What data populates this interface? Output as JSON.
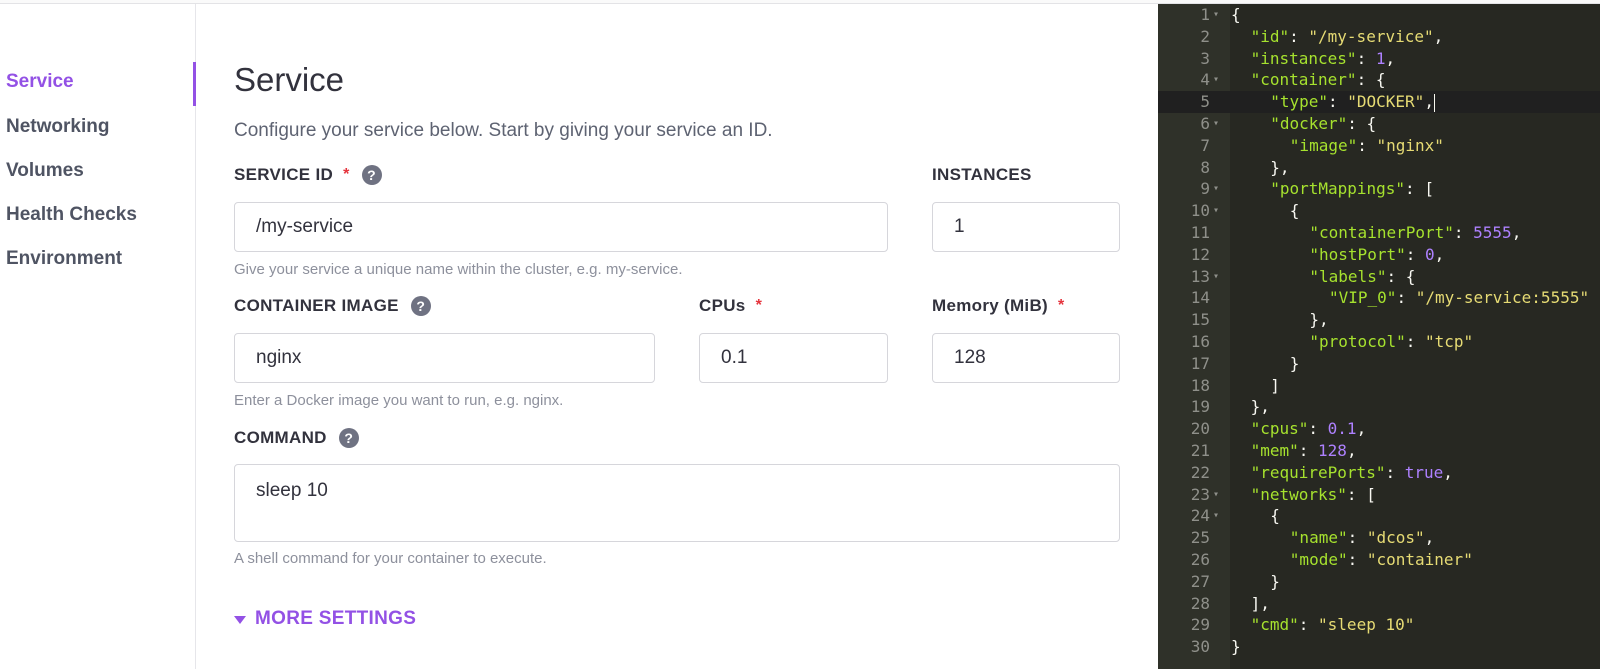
{
  "sidebar": {
    "items": [
      {
        "label": "Service",
        "active": true
      },
      {
        "label": "Networking",
        "active": false
      },
      {
        "label": "Volumes",
        "active": false
      },
      {
        "label": "Health Checks",
        "active": false
      },
      {
        "label": "Environment",
        "active": false
      }
    ]
  },
  "main": {
    "title": "Service",
    "description": "Configure your service below. Start by giving your service an ID.",
    "help_icon": "?",
    "required_mark": "*",
    "service_id": {
      "label": "SERVICE ID",
      "value": "/my-service",
      "hint": "Give your service a unique name within the cluster, e.g. my-service."
    },
    "instances": {
      "label": "INSTANCES",
      "value": "1"
    },
    "container_image": {
      "label": "CONTAINER IMAGE",
      "value": "nginx",
      "hint": "Enter a Docker image you want to run, e.g. nginx."
    },
    "cpus": {
      "label": "CPUs",
      "value": "0.1"
    },
    "memory": {
      "label": "Memory (MiB)",
      "value": "128"
    },
    "command": {
      "label": "COMMAND",
      "value": "sleep 10",
      "hint": "A shell command for your container to execute."
    },
    "more_settings": "MORE SETTINGS"
  },
  "editor": {
    "active_line": 5,
    "lines": [
      {
        "n": "1",
        "fold": true,
        "indent": 0,
        "tokens": [
          [
            "p",
            "{"
          ]
        ]
      },
      {
        "n": "2",
        "fold": false,
        "indent": 1,
        "tokens": [
          [
            "k",
            "\"id\""
          ],
          [
            "p",
            ": "
          ],
          [
            "s",
            "\"/my-service\""
          ],
          [
            "p",
            ","
          ]
        ]
      },
      {
        "n": "3",
        "fold": false,
        "indent": 1,
        "tokens": [
          [
            "k",
            "\"instances\""
          ],
          [
            "p",
            ": "
          ],
          [
            "n",
            "1"
          ],
          [
            "p",
            ","
          ]
        ]
      },
      {
        "n": "4",
        "fold": true,
        "indent": 1,
        "tokens": [
          [
            "k",
            "\"container\""
          ],
          [
            "p",
            ": {"
          ]
        ]
      },
      {
        "n": "5",
        "fold": false,
        "indent": 2,
        "tokens": [
          [
            "k",
            "\"type\""
          ],
          [
            "p",
            ": "
          ],
          [
            "s",
            "\"DOCKER\""
          ],
          [
            "p",
            ","
          ]
        ]
      },
      {
        "n": "6",
        "fold": true,
        "indent": 2,
        "tokens": [
          [
            "k",
            "\"docker\""
          ],
          [
            "p",
            ": {"
          ]
        ]
      },
      {
        "n": "7",
        "fold": false,
        "indent": 3,
        "tokens": [
          [
            "k",
            "\"image\""
          ],
          [
            "p",
            ": "
          ],
          [
            "s",
            "\"nginx\""
          ]
        ]
      },
      {
        "n": "8",
        "fold": false,
        "indent": 2,
        "tokens": [
          [
            "p",
            "},"
          ]
        ]
      },
      {
        "n": "9",
        "fold": true,
        "indent": 2,
        "tokens": [
          [
            "k",
            "\"portMappings\""
          ],
          [
            "p",
            ": ["
          ]
        ]
      },
      {
        "n": "10",
        "fold": true,
        "indent": 3,
        "tokens": [
          [
            "p",
            "{"
          ]
        ]
      },
      {
        "n": "11",
        "fold": false,
        "indent": 4,
        "tokens": [
          [
            "k",
            "\"containerPort\""
          ],
          [
            "p",
            ": "
          ],
          [
            "n",
            "5555"
          ],
          [
            "p",
            ","
          ]
        ]
      },
      {
        "n": "12",
        "fold": false,
        "indent": 4,
        "tokens": [
          [
            "k",
            "\"hostPort\""
          ],
          [
            "p",
            ": "
          ],
          [
            "n",
            "0"
          ],
          [
            "p",
            ","
          ]
        ]
      },
      {
        "n": "13",
        "fold": true,
        "indent": 4,
        "tokens": [
          [
            "k",
            "\"labels\""
          ],
          [
            "p",
            ": {"
          ]
        ]
      },
      {
        "n": "14",
        "fold": false,
        "indent": 5,
        "tokens": [
          [
            "k",
            "\"VIP_0\""
          ],
          [
            "p",
            ": "
          ],
          [
            "s",
            "\"/my-service:5555\""
          ]
        ]
      },
      {
        "n": "15",
        "fold": false,
        "indent": 4,
        "tokens": [
          [
            "p",
            "},"
          ]
        ]
      },
      {
        "n": "16",
        "fold": false,
        "indent": 4,
        "tokens": [
          [
            "k",
            "\"protocol\""
          ],
          [
            "p",
            ": "
          ],
          [
            "s",
            "\"tcp\""
          ]
        ]
      },
      {
        "n": "17",
        "fold": false,
        "indent": 3,
        "tokens": [
          [
            "p",
            "}"
          ]
        ]
      },
      {
        "n": "18",
        "fold": false,
        "indent": 2,
        "tokens": [
          [
            "p",
            "]"
          ]
        ]
      },
      {
        "n": "19",
        "fold": false,
        "indent": 1,
        "tokens": [
          [
            "p",
            "},"
          ]
        ]
      },
      {
        "n": "20",
        "fold": false,
        "indent": 1,
        "tokens": [
          [
            "k",
            "\"cpus\""
          ],
          [
            "p",
            ": "
          ],
          [
            "n",
            "0.1"
          ],
          [
            "p",
            ","
          ]
        ]
      },
      {
        "n": "21",
        "fold": false,
        "indent": 1,
        "tokens": [
          [
            "k",
            "\"mem\""
          ],
          [
            "p",
            ": "
          ],
          [
            "n",
            "128"
          ],
          [
            "p",
            ","
          ]
        ]
      },
      {
        "n": "22",
        "fold": false,
        "indent": 1,
        "tokens": [
          [
            "k",
            "\"requirePorts\""
          ],
          [
            "p",
            ": "
          ],
          [
            "n",
            "true"
          ],
          [
            "p",
            ","
          ]
        ]
      },
      {
        "n": "23",
        "fold": true,
        "indent": 1,
        "tokens": [
          [
            "k",
            "\"networks\""
          ],
          [
            "p",
            ": ["
          ]
        ]
      },
      {
        "n": "24",
        "fold": true,
        "indent": 2,
        "tokens": [
          [
            "p",
            "{"
          ]
        ]
      },
      {
        "n": "25",
        "fold": false,
        "indent": 3,
        "tokens": [
          [
            "k",
            "\"name\""
          ],
          [
            "p",
            ": "
          ],
          [
            "s",
            "\"dcos\""
          ],
          [
            "p",
            ","
          ]
        ]
      },
      {
        "n": "26",
        "fold": false,
        "indent": 3,
        "tokens": [
          [
            "k",
            "\"mode\""
          ],
          [
            "p",
            ": "
          ],
          [
            "s",
            "\"container\""
          ]
        ]
      },
      {
        "n": "27",
        "fold": false,
        "indent": 2,
        "tokens": [
          [
            "p",
            "}"
          ]
        ]
      },
      {
        "n": "28",
        "fold": false,
        "indent": 1,
        "tokens": [
          [
            "p",
            "],"
          ]
        ]
      },
      {
        "n": "29",
        "fold": false,
        "indent": 1,
        "tokens": [
          [
            "k",
            "\"cmd\""
          ],
          [
            "p",
            ": "
          ],
          [
            "s",
            "\"sleep 10\""
          ]
        ]
      },
      {
        "n": "30",
        "fold": false,
        "indent": 0,
        "tokens": [
          [
            "p",
            "}"
          ]
        ]
      }
    ]
  }
}
